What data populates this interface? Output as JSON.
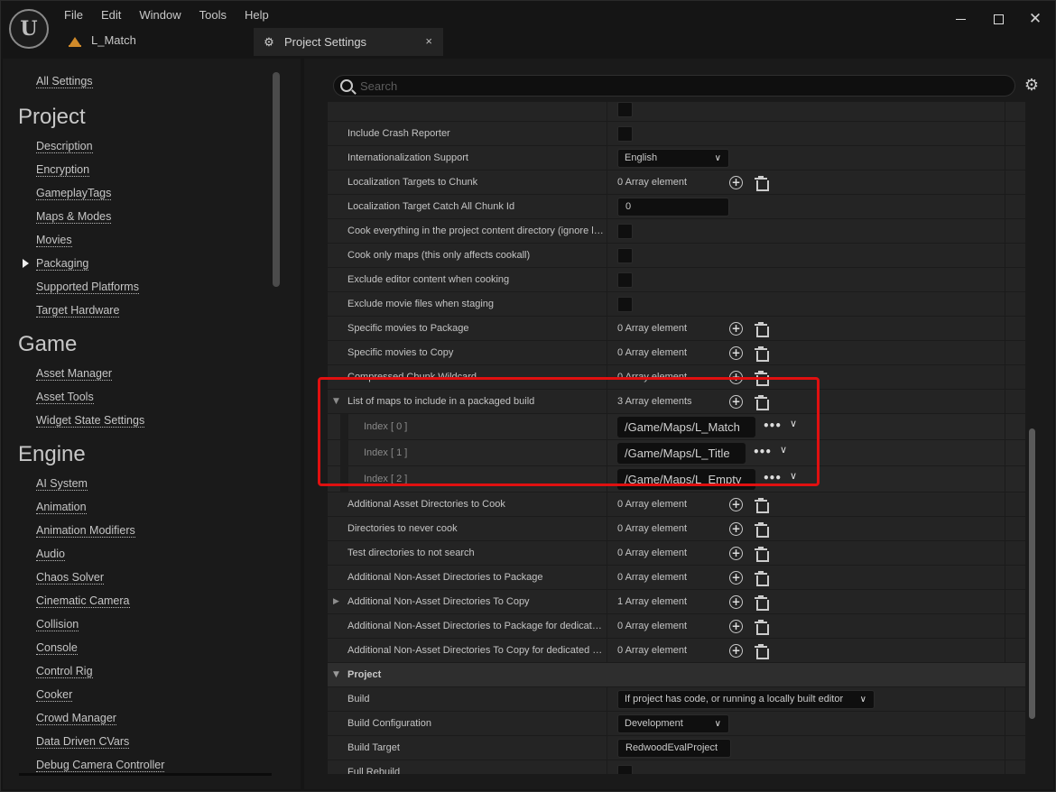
{
  "titlebar": {
    "menu": [
      "File",
      "Edit",
      "Window",
      "Tools",
      "Help"
    ],
    "level_tab": "L_Match",
    "doc_tab": "Project Settings",
    "close_tab": "×"
  },
  "window_controls": {
    "minimize": "minimize",
    "maximize": "maximize",
    "close": "✕"
  },
  "sidebar": {
    "all_settings": "All Settings",
    "sections": [
      {
        "title": "Project",
        "items": [
          "Description",
          "Encryption",
          "GameplayTags",
          "Maps & Modes",
          "Movies",
          "Packaging",
          "Supported Platforms",
          "Target Hardware"
        ]
      },
      {
        "title": "Game",
        "items": [
          "Asset Manager",
          "Asset Tools",
          "Widget State Settings"
        ]
      },
      {
        "title": "Engine",
        "items": [
          "AI System",
          "Animation",
          "Animation Modifiers",
          "Audio",
          "Chaos Solver",
          "Cinematic Camera",
          "Collision",
          "Console",
          "Control Rig",
          "Cooker",
          "Crowd Manager",
          "Data Driven CVars",
          "Debug Camera Controller"
        ]
      }
    ],
    "selected": "Packaging"
  },
  "search": {
    "placeholder": "Search",
    "value": ""
  },
  "rows": {
    "r0": {
      "name": "Include Crash Reporter"
    },
    "r1": {
      "name": "Internationalization Support",
      "value": "English"
    },
    "r2": {
      "name": "Localization Targets to Chunk",
      "value": "0 Array element"
    },
    "r3": {
      "name": "Localization Target Catch All Chunk Id",
      "value": "0"
    },
    "r4": {
      "name": "Cook everything in the project content directory (ignore list of maps below)"
    },
    "r5": {
      "name": "Cook only maps (this only affects cookall)"
    },
    "r6": {
      "name": "Exclude editor content when cooking"
    },
    "r7": {
      "name": "Exclude movie files when staging"
    },
    "r8": {
      "name": "Specific movies to Package",
      "value": "0 Array element"
    },
    "r9": {
      "name": "Specific movies to Copy",
      "value": "0 Array element"
    },
    "r10": {
      "name": "Compressed Chunk Wildcard",
      "value": "0 Array element"
    },
    "r11": {
      "name": "List of maps to include in a packaged build",
      "value": "3 Array elements"
    },
    "idx0": {
      "name": "Index [ 0 ]",
      "value": "/Game/Maps/L_Match"
    },
    "idx1": {
      "name": "Index [ 1 ]",
      "value": "/Game/Maps/L_Title"
    },
    "idx2": {
      "name": "Index [ 2 ]",
      "value": "/Game/Maps/L_Empty"
    },
    "r12": {
      "name": "Additional Asset Directories to Cook",
      "value": "0 Array element"
    },
    "r13": {
      "name": "Directories to never cook",
      "value": "0 Array element"
    },
    "r14": {
      "name": "Test directories to not search",
      "value": "0 Array element"
    },
    "r15": {
      "name": "Additional Non-Asset Directories to Package",
      "value": "0 Array element"
    },
    "r16": {
      "name": "Additional Non-Asset Directories To Copy",
      "value": "1 Array element"
    },
    "r17": {
      "name": "Additional Non-Asset Directories to Package for dedicated server only",
      "value": "0 Array element"
    },
    "r18": {
      "name": "Additional Non-Asset Directories To Copy for dedicated server only",
      "value": "0 Array element"
    },
    "sec_project": {
      "name": "Project"
    },
    "r19": {
      "name": "Build",
      "value": "If project has code, or running a locally built editor"
    },
    "r20": {
      "name": "Build Configuration",
      "value": "Development"
    },
    "r21": {
      "name": "Build Target",
      "value": "RedwoodEvalProject"
    },
    "r22": {
      "name": "Full Rebuild"
    }
  },
  "icons": {
    "dots": "•••",
    "chevron": "⌄",
    "plus": "+",
    "gear": "⚙",
    "expanded": "▼",
    "collapsed": "▶"
  },
  "colors": {
    "highlight": "#e01010",
    "background": "#151515",
    "panel": "#242424"
  }
}
